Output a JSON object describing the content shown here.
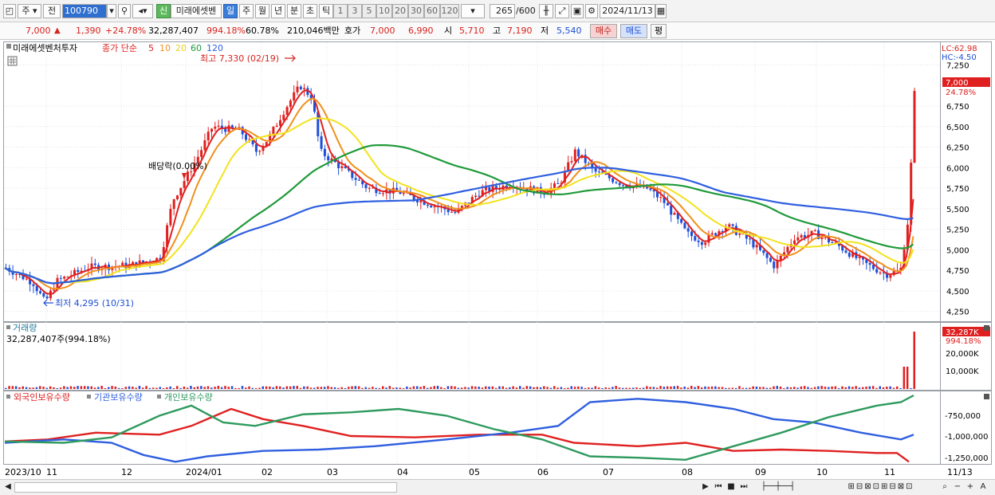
{
  "toolbar": {
    "type_label": "주",
    "range_label": "전",
    "code": "100790",
    "badge": "신",
    "name": "미래에셋벤",
    "periods": [
      "일",
      "주",
      "월",
      "년",
      "분",
      "초",
      "틱"
    ],
    "minutes": [
      "1",
      "3",
      "5",
      "10",
      "20",
      "30",
      "60",
      "120"
    ],
    "count": "265",
    "count_total": "/600",
    "date": "2024/11/13"
  },
  "quote": {
    "price": "7,000",
    "up_arrow": "▲",
    "change": "1,390",
    "change_pct": "+24.78%",
    "volume": "32,287,407",
    "volume_pct": "994.18%",
    "turnover": "60.78%",
    "amount": "210,046백만",
    "hoga_label": "호가",
    "hoga_ask": "7,000",
    "hoga_bid": "6,990",
    "open_label": "시",
    "open": "5,710",
    "high_label": "고",
    "high": "7,190",
    "low_label": "저",
    "low": "5,540",
    "buy_label": "매수",
    "sell_label": "매도",
    "flat_label": "평"
  },
  "price_pane": {
    "stock_name": "미래에셋벤처투자",
    "legend_title": "종가 단순",
    "ma_labels": [
      "5",
      "10",
      "20",
      "60",
      "120"
    ],
    "ma_colors": [
      "#e02020",
      "#f0901c",
      "#f2e31c",
      "#1f9a3a",
      "#2f5fe0"
    ],
    "high_note": "최고 7,330 (02/19)",
    "low_note": "최저 4,295 (10/31)",
    "dividend_note": "배당락(0.00%)",
    "lc_label": "LC:62.98",
    "hc_label": "HC:-4.50",
    "current_tag": "7,000",
    "current_pct": "24.78%",
    "y_ticks": [
      "7,250",
      "6,750",
      "6,500",
      "6,250",
      "6,000",
      "5,750",
      "5,500",
      "5,250",
      "5,000",
      "4,750",
      "4,500",
      "4,250"
    ]
  },
  "volume_pane": {
    "title": "거래량",
    "value_text": "32,287,407주(994.18%)",
    "current_tag": "32,287K",
    "current_pct": "994.18%",
    "y_ticks": [
      "20,000K",
      "10,000K"
    ]
  },
  "holdings_pane": {
    "legend": [
      "외국인보유수량",
      "기관보유수량",
      "개인보유수량"
    ],
    "colors": [
      "#e02020",
      "#2f5fe0",
      "#2e9a5e"
    ],
    "y_ticks": [
      "-750,000",
      "-1,000,000",
      "-1,250,000"
    ]
  },
  "x_axis": {
    "labels": [
      "2023/10",
      "11",
      "12",
      "2024/01",
      "02",
      "03",
      "04",
      "05",
      "06",
      "07",
      "08",
      "09",
      "10",
      "11",
      "11/13"
    ]
  }
}
